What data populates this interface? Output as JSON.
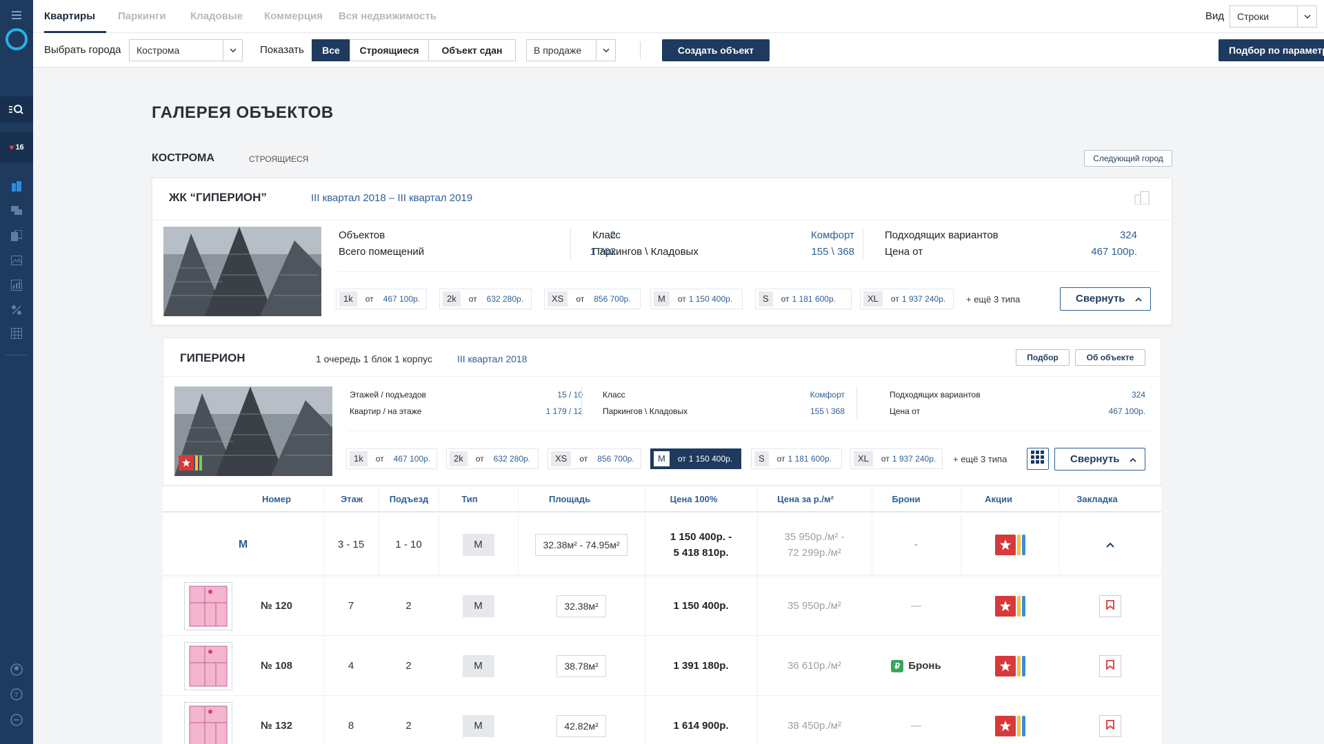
{
  "topbar": {
    "tabs": [
      "Квартиры",
      "Паркинги",
      "Кладовые",
      "Коммерция",
      "Вся недвижимость"
    ],
    "view_label": "Вид",
    "view_value": "Строки"
  },
  "filters": {
    "city_label": "Выбрать города",
    "city_value": "Кострома",
    "show_label": "Показать",
    "segments": [
      "Все",
      "Строящиеся",
      "Объект сдан"
    ],
    "status_value": "В продаже",
    "create_button": "Создать объект",
    "params_button": "Подбор по параметрам"
  },
  "sidebar": {
    "favorites_count": "16"
  },
  "page": {
    "title": "ГАЛЕРЕЯ ОБЪЕКТОВ",
    "city": "КОСТРОМА",
    "city_status": "СТРОЯЩИЕСЯ",
    "next_city": "Следующий город"
  },
  "complex": {
    "name": "ЖК “ГИПЕРИОН”",
    "period": "III квартал 2018 – III квартал 2019",
    "stats": [
      {
        "label": "Объектов",
        "value": "2"
      },
      {
        "label": "Всего помещений",
        "value": "1 702"
      },
      {
        "label": "Класс",
        "value": "Комфорт"
      },
      {
        "label": "Паркингов \\ Кладовых",
        "value": "155 \\ 368"
      },
      {
        "label": "Подходящих вариантов",
        "value": "324"
      },
      {
        "label": "Цена от",
        "value": "467 100р."
      }
    ],
    "types": [
      {
        "code": "1k",
        "from": "от",
        "price": "467 100р."
      },
      {
        "code": "2k",
        "from": "от",
        "price": "632 280р."
      },
      {
        "code": "XS",
        "from": "от",
        "price": "856 700р."
      },
      {
        "code": "M",
        "from": "от",
        "price": "1 150 400р."
      },
      {
        "code": "S",
        "from": "от",
        "price": "1 181 600р."
      },
      {
        "code": "XL",
        "from": "от",
        "price": "1 937 240р."
      }
    ],
    "more_types": "+ ещё 3 типа",
    "collapse": "Свернуть"
  },
  "building": {
    "name": "ГИПЕРИОН",
    "subtitle": "1 очередь 1 блок 1 корпус",
    "period": "III квартал 2018",
    "btn_pick": "Подбор",
    "btn_about": "Об объекте",
    "stats": [
      {
        "label": "Этажей / подъездов",
        "value": "15 / 10"
      },
      {
        "label": "Квартир / на этаже",
        "value": "1 179 / 12"
      },
      {
        "label": "Класс",
        "value": "Комфорт"
      },
      {
        "label": "Паркингов \\ Кладовых",
        "value": "155 \\ 368"
      },
      {
        "label": "Подходящих вариантов",
        "value": "324"
      },
      {
        "label": "Цена от",
        "value": "467 100р."
      }
    ],
    "types": [
      {
        "code": "1k",
        "from": "от",
        "price": "467 100р."
      },
      {
        "code": "2k",
        "from": "от",
        "price": "632 280р."
      },
      {
        "code": "XS",
        "from": "от",
        "price": "856 700р."
      },
      {
        "code": "M",
        "from": "от",
        "price": "1 150 400р."
      },
      {
        "code": "S",
        "from": "от",
        "price": "1 181 600р."
      },
      {
        "code": "XL",
        "from": "от",
        "price": "1 937 240р."
      }
    ],
    "more_types": "+ ещё 3 типа",
    "collapse": "Свернуть"
  },
  "table": {
    "headers": [
      "Номер",
      "Этаж",
      "Подъезд",
      "Тип",
      "Площадь",
      "Цена 100%",
      "Цена за р./м²",
      "Брони",
      "Акции",
      "Закладка"
    ],
    "group": {
      "code": "M",
      "floors": "3 - 15",
      "entrance": "1 - 10",
      "type": "M",
      "area": "32.38м² - 74.95м²",
      "price_1": "1 150 400р.  -",
      "price_2": "5 418 810р.",
      "ppm_1": "35 950р./м²  -",
      "ppm_2": "72 299р./м²",
      "booking": "-"
    },
    "rows": [
      {
        "number": "№ 120",
        "floor": "7",
        "entrance": "2",
        "type": "M",
        "area": "32.38м²",
        "price": "1 150 400р.",
        "ppm": "35 950р./м²",
        "booking": "—"
      },
      {
        "number": "№ 108",
        "floor": "4",
        "entrance": "2",
        "type": "M",
        "area": "38.78м²",
        "price": "1 391 180р.",
        "ppm": "36 610р./м²",
        "booking": "Бронь"
      },
      {
        "number": "№ 132",
        "floor": "8",
        "entrance": "2",
        "type": "M",
        "area": "42.82м²",
        "price": "1 614 900р.",
        "ppm": "38 450р./м²",
        "booking": "—"
      }
    ]
  },
  "colors": {
    "brand": "#1e3a5f",
    "accent_cyan": "#27b3e0",
    "star_red": "#d8393d",
    "bar_yellow": "#f5c23b",
    "bar_green": "#7ec85a",
    "bar_blue": "#3d8be0",
    "booking_green": "#3aa55c"
  }
}
